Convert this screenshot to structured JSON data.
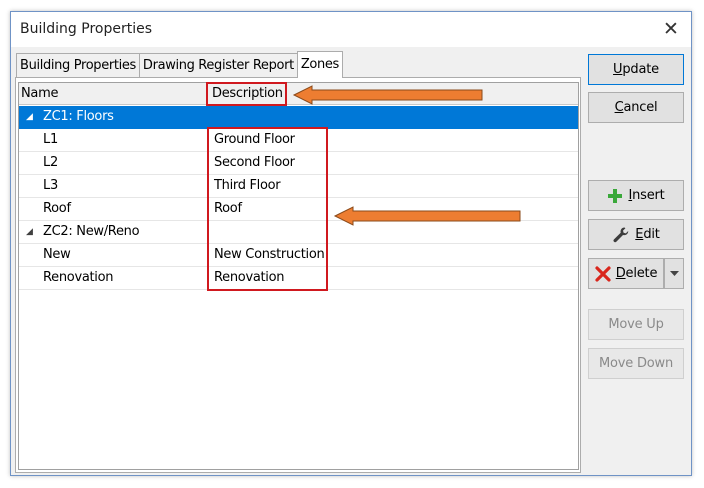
{
  "window": {
    "title": "Building Properties"
  },
  "tabs": [
    {
      "label": "Building Properties",
      "active": false
    },
    {
      "label": "Drawing Register Report",
      "active": false
    },
    {
      "label": "Zones",
      "active": true
    }
  ],
  "grid": {
    "columns": {
      "name": "Name",
      "description": "Description"
    },
    "rows": [
      {
        "type": "group",
        "name": "ZC1: Floors",
        "description": "",
        "selected": true
      },
      {
        "type": "item",
        "name": "L1",
        "description": "Ground Floor"
      },
      {
        "type": "item",
        "name": "L2",
        "description": "Second Floor"
      },
      {
        "type": "item",
        "name": "L3",
        "description": "Third Floor"
      },
      {
        "type": "item",
        "name": "Roof",
        "description": "Roof"
      },
      {
        "type": "group",
        "name": "ZC2: New/Reno",
        "description": ""
      },
      {
        "type": "item",
        "name": "New",
        "description": "New Construction"
      },
      {
        "type": "item",
        "name": "Renovation",
        "description": "Renovation"
      }
    ]
  },
  "buttons": {
    "update": {
      "first": "U",
      "rest": "pdate"
    },
    "cancel": {
      "first": "C",
      "rest": "ancel"
    },
    "insert": {
      "first": "I",
      "rest": "nsert"
    },
    "edit": {
      "first": "E",
      "rest": "dit"
    },
    "delete": {
      "first": "D",
      "rest": "elete"
    },
    "move_up": "Move Up",
    "move_down": "Move Down"
  },
  "colors": {
    "selection": "#0078d7",
    "annotation_box": "#d0191f",
    "annotation_arrow": "#ed7d31",
    "insert_icon": "#3aa83a",
    "delete_icon": "#d9261c"
  },
  "icons": {
    "expander": "triangle-down",
    "insert": "plus-icon",
    "edit": "wrench-icon",
    "delete": "x-icon",
    "close": "close-icon"
  }
}
